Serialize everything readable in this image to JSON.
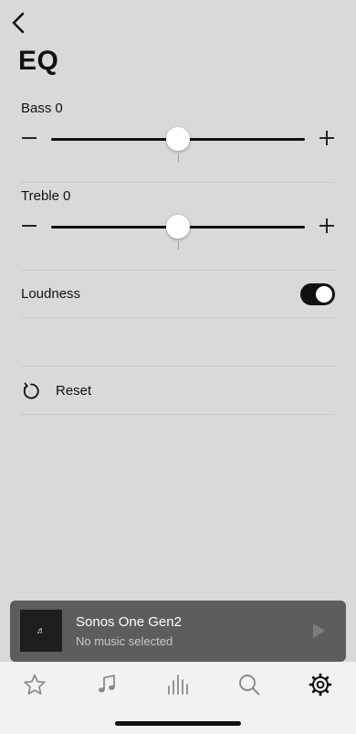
{
  "page": {
    "title": "EQ"
  },
  "bass": {
    "label": "Bass",
    "value": "0",
    "level": 0,
    "min": -10,
    "max": 10
  },
  "treble": {
    "label": "Treble",
    "value": "0",
    "level": 0,
    "min": -10,
    "max": 10
  },
  "loudness": {
    "label": "Loudness",
    "enabled": true
  },
  "reset": {
    "label": "Reset"
  },
  "now_playing": {
    "title": "Sonos One Gen2",
    "subtitle": "No music selected",
    "art_glyph": "♬"
  },
  "tabs": [
    {
      "name": "favorites",
      "icon": "star-icon"
    },
    {
      "name": "browse",
      "icon": "music-note-icon"
    },
    {
      "name": "rooms",
      "icon": "equalizer-bars-icon"
    },
    {
      "name": "search",
      "icon": "search-icon"
    },
    {
      "name": "settings",
      "icon": "gear-icon",
      "active": true
    }
  ]
}
